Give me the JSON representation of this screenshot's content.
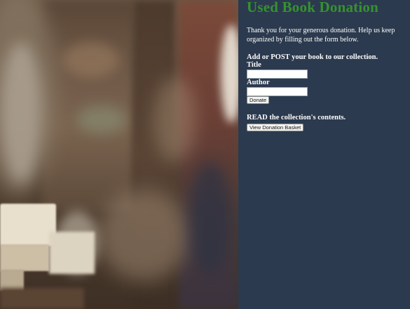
{
  "page": {
    "title": "Used Book Donation",
    "intro": "Thank you for your generous donation. Help us keep organized by filling out the form below."
  },
  "add_section": {
    "heading": "Add or POST your book to our collection.",
    "title_label": "Title",
    "title_value": "",
    "author_label": "Author",
    "author_value": "",
    "donate_button": "Donate"
  },
  "read_section": {
    "heading": "READ the collection's contents.",
    "basket_button": "View Donation Basket"
  },
  "colors": {
    "panel_background": "#2b3a4e",
    "title_green": "#36922f",
    "text": "#ffffff"
  }
}
